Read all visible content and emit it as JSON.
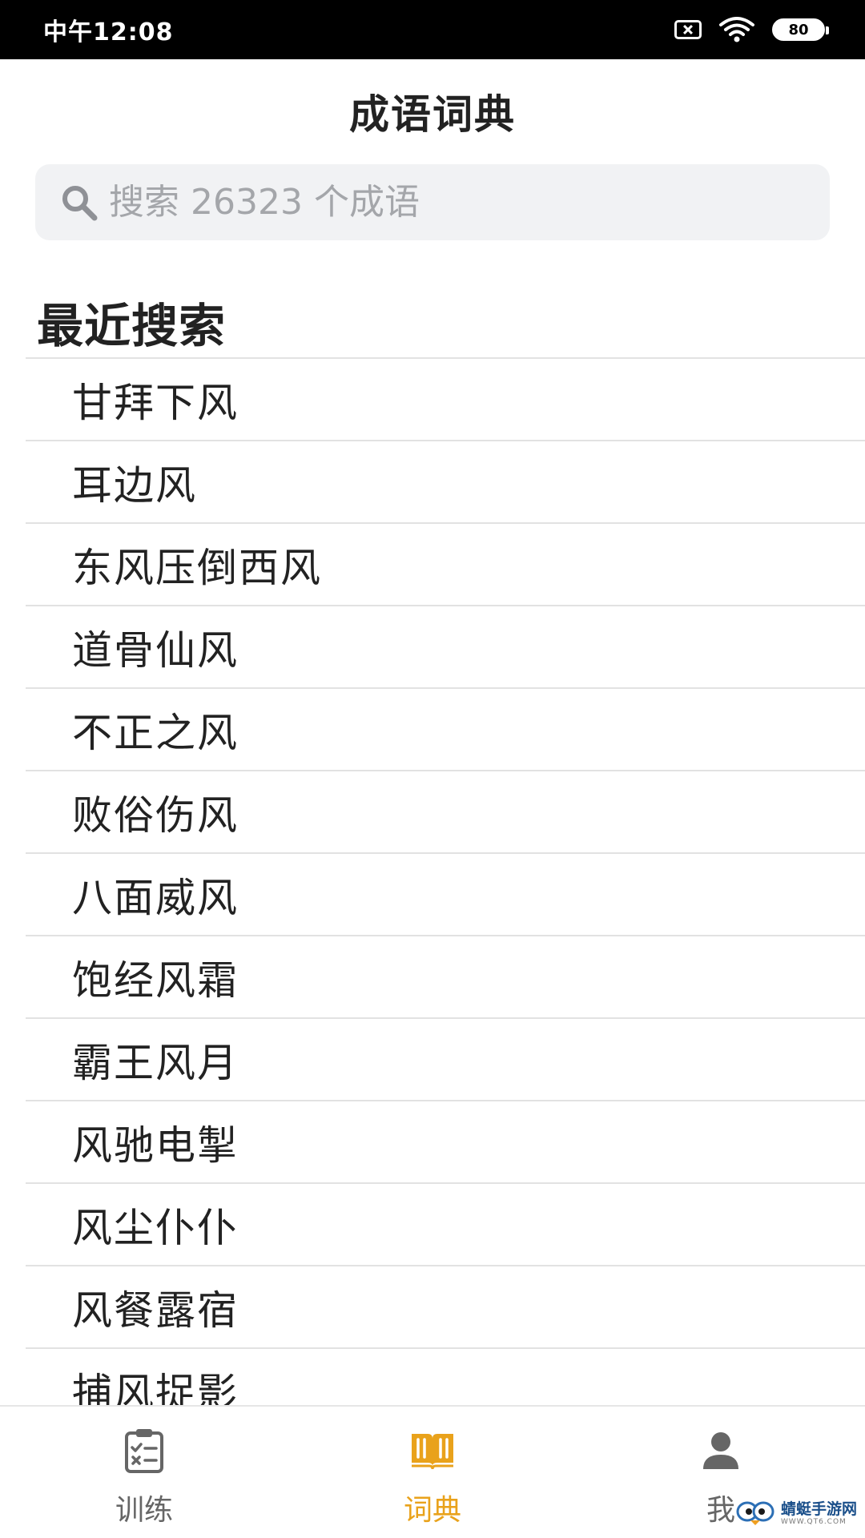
{
  "status_bar": {
    "time": "中午12:08",
    "battery": "80",
    "icons": [
      "sim-off-icon",
      "wifi-icon",
      "battery-icon"
    ]
  },
  "header": {
    "title": "成语词典"
  },
  "search": {
    "placeholder": "搜索 26323 个成语",
    "value": "",
    "icon": "search-icon"
  },
  "recent": {
    "title": "最近搜索",
    "items": [
      "甘拜下风",
      "耳边风",
      "东风压倒西风",
      "道骨仙风",
      "不正之风",
      "败俗伤风",
      "八面威风",
      "饱经风霜",
      "霸王风月",
      "风驰电掣",
      "风尘仆仆",
      "风餐露宿",
      "捕风捉影"
    ]
  },
  "tabs": [
    {
      "label": "训练",
      "icon": "clipboard-checklist-icon",
      "active": false
    },
    {
      "label": "词典",
      "icon": "open-book-icon",
      "active": true
    },
    {
      "label": "我",
      "icon": "person-icon",
      "active": false
    }
  ],
  "watermark": {
    "name": "蜻蜓手游网",
    "url": "WWW.QT6.COM"
  },
  "colors": {
    "accent": "#e9a21b",
    "inactive": "#666666",
    "search_bg": "#f1f2f4",
    "divider": "#e2e2e2",
    "status_bar_bg": "#000000"
  }
}
